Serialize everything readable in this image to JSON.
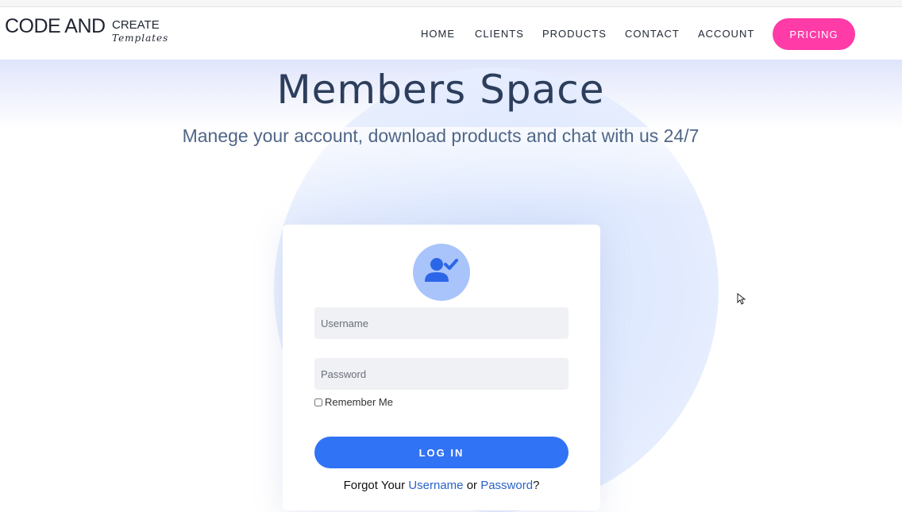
{
  "logo": {
    "main": "CODE AND",
    "sub1": "CREATE",
    "sub2": "Templates"
  },
  "nav": {
    "items": [
      {
        "label": "HOME"
      },
      {
        "label": "CLIENTS"
      },
      {
        "label": "PRODUCTS"
      },
      {
        "label": "CONTACT"
      },
      {
        "label": "ACCOUNT"
      }
    ],
    "pricing_label": "PRICING"
  },
  "hero": {
    "title": "Members Space",
    "subtitle": "Manege your account, download products and chat with us 24/7"
  },
  "login": {
    "avatar_icon": "user-check-icon",
    "username_placeholder": "Username",
    "username_value": "",
    "password_placeholder": "Password",
    "password_value": "",
    "remember_label": "Remember Me",
    "remember_checked": false,
    "login_label": "LOG IN",
    "forgot_prefix": "Forgot Your",
    "forgot_username": "Username",
    "forgot_or": "or",
    "forgot_password": "Password",
    "forgot_suffix": "?"
  },
  "colors": {
    "accent_pink": "#ff3ba8",
    "accent_blue": "#3173f5",
    "title": "#2d3e5c",
    "avatar_bg": "#a9c4fb"
  }
}
